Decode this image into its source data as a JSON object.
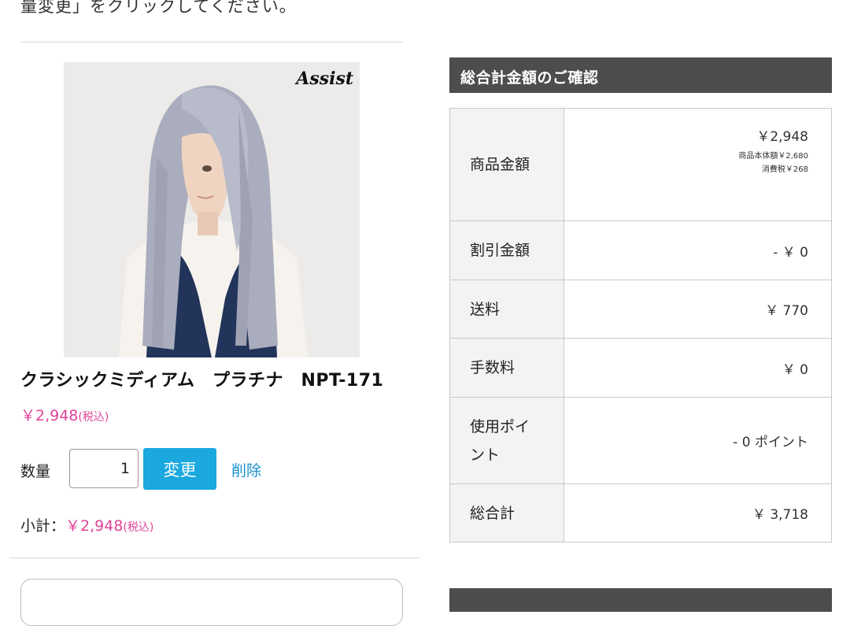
{
  "instruction_text": "量変更」をクリックしてください。",
  "product": {
    "brand_logo": "Assist",
    "name": "クラシックミディアム　プラチナ　NPT-171",
    "price": "￥2,948",
    "price_tax_note": "(税込)",
    "quantity_label": "数量",
    "quantity_value": "1",
    "change_label": "変更",
    "delete_label": "削除",
    "subtotal_label": "小計：",
    "subtotal_amount": "￥2,948",
    "subtotal_tax_note": "(税込)"
  },
  "summary": {
    "title": "総合計金額のご確認",
    "rows": {
      "item": {
        "label": "商品金額",
        "value": "￥2,948",
        "base": "商品本体額￥2,680",
        "tax": "消費税￥268"
      },
      "discount": {
        "label": "割引金額",
        "value": "- ￥ 0"
      },
      "shipping": {
        "label": "送料",
        "value": "￥ 770"
      },
      "fee": {
        "label": "手数料",
        "value": "￥ 0"
      },
      "points": {
        "label": "使用ポイント",
        "value": "- 0 ポイント"
      },
      "total": {
        "label": "総合計",
        "value": "￥ 3,718"
      }
    }
  },
  "colors": {
    "accent_pink": "#e0449a",
    "button_blue": "#1aa8df",
    "link_blue": "#1a8fd0",
    "header_gray": "#4d4d4d",
    "discount_brown": "#8a4b14"
  }
}
